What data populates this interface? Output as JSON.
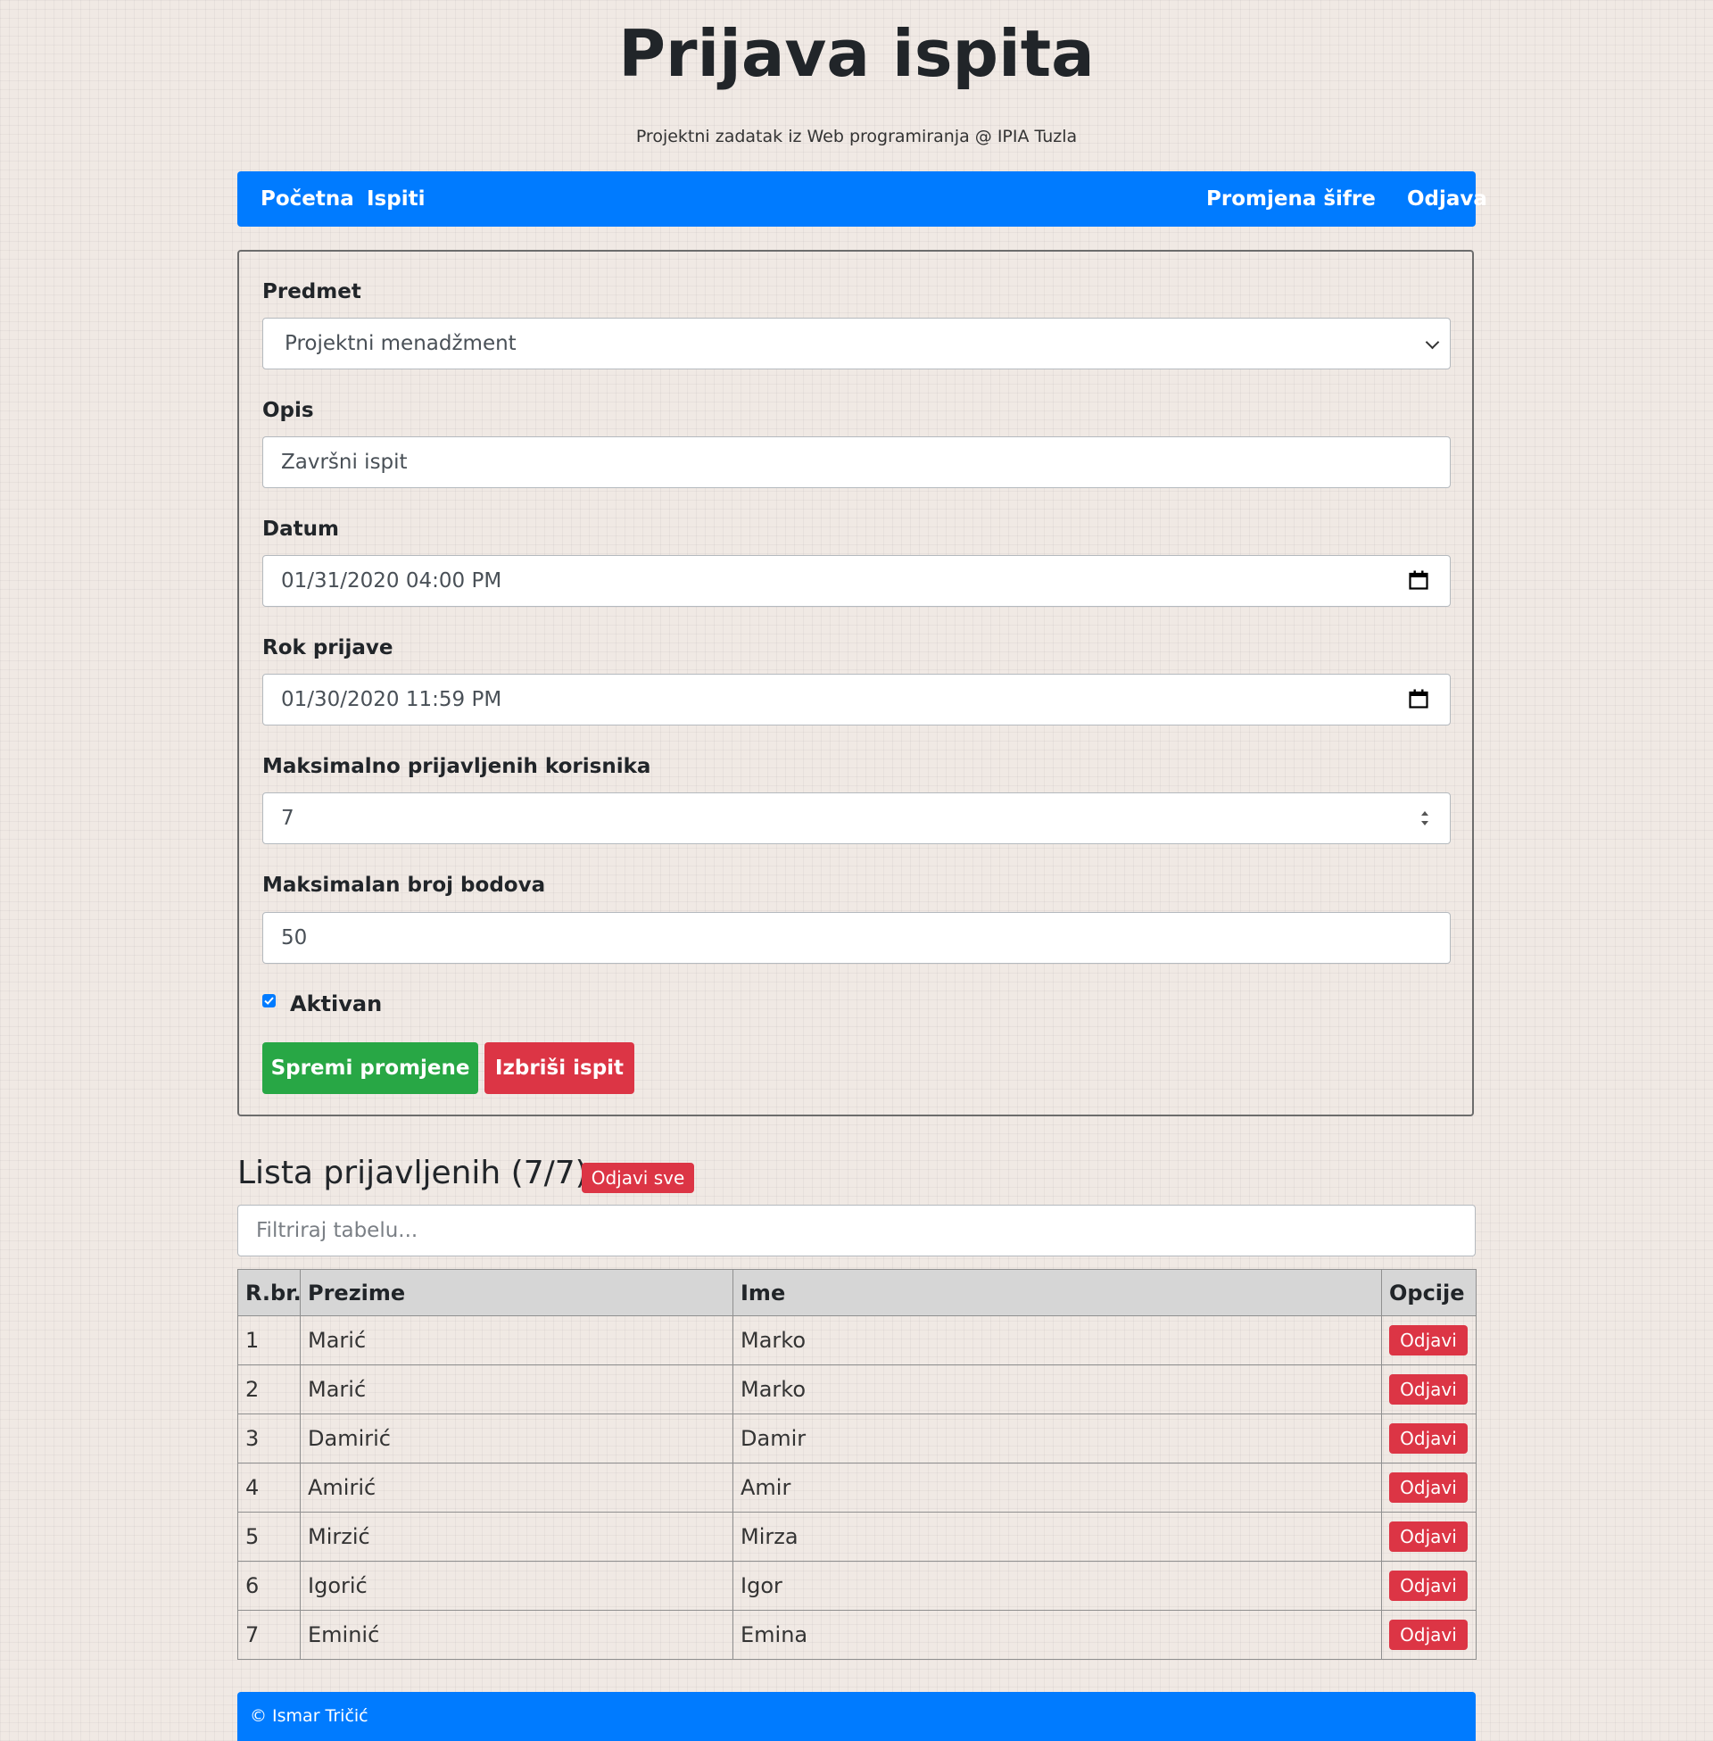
{
  "header": {
    "title": "Prijava ispita",
    "subtitle": "Projektni zadatak iz Web programiranja @ IPIA Tuzla"
  },
  "nav": {
    "home": "Početna",
    "exams": "Ispiti",
    "change_password": "Promjena šifre",
    "logout": "Odjava"
  },
  "form": {
    "subject_label": "Predmet",
    "subject_value": "Projektni menadžment",
    "description_label": "Opis",
    "description_value": "Završni ispit",
    "date_label": "Datum",
    "date_value": "01/31/2020 04:00 PM",
    "deadline_label": "Rok prijave",
    "deadline_value": "01/30/2020 11:59 PM",
    "max_users_label": "Maksimalno prijavljenih korisnika",
    "max_users_value": "7",
    "max_points_label": "Maksimalan broj bodova",
    "max_points_value": "50",
    "active_label": "Aktivan",
    "active_checked": true,
    "save_label": "Spremi promjene",
    "delete_label": "Izbriši ispit"
  },
  "list": {
    "title": "Lista prijavljenih (7/7):",
    "unregister_all_label": "Odjavi sve",
    "filter_placeholder": "Filtriraj tabelu...",
    "columns": [
      "R.br.",
      "Prezime",
      "Ime",
      "Opcije"
    ],
    "row_action_label": "Odjavi",
    "rows": [
      {
        "num": "1",
        "surname": "Marić",
        "name": "Marko"
      },
      {
        "num": "2",
        "surname": "Marić",
        "name": "Marko"
      },
      {
        "num": "3",
        "surname": "Damirić",
        "name": "Damir"
      },
      {
        "num": "4",
        "surname": "Amirić",
        "name": "Amir"
      },
      {
        "num": "5",
        "surname": "Mirzić",
        "name": "Mirza"
      },
      {
        "num": "6",
        "surname": "Igorić",
        "name": "Igor"
      },
      {
        "num": "7",
        "surname": "Eminić",
        "name": "Emina"
      }
    ]
  },
  "footer": {
    "text": "© Ismar Tričić"
  },
  "colors": {
    "primary": "#007bff",
    "success": "#28a745",
    "danger": "#dc3545"
  }
}
